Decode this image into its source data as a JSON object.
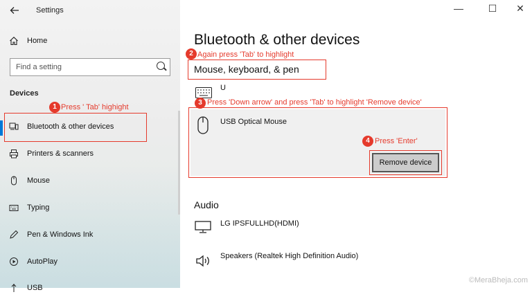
{
  "window": {
    "title": "Settings",
    "controls": {
      "minimize": "—",
      "maximize": "☐",
      "close": "✕"
    }
  },
  "sidebar": {
    "home_label": "Home",
    "search_placeholder": "Find a setting",
    "section_label": "Devices",
    "items": [
      {
        "label": "Bluetooth & other devices",
        "icon": "bluetooth-devices-icon",
        "selected": true
      },
      {
        "label": "Printers & scanners",
        "icon": "printer-icon"
      },
      {
        "label": "Mouse",
        "icon": "mouse-icon"
      },
      {
        "label": "Typing",
        "icon": "keyboard-icon"
      },
      {
        "label": "Pen & Windows Ink",
        "icon": "pen-icon"
      },
      {
        "label": "AutoPlay",
        "icon": "autoplay-icon"
      },
      {
        "label": "USB",
        "icon": "usb-icon"
      }
    ]
  },
  "main": {
    "title": "Bluetooth & other devices",
    "group_heading": "Mouse, keyboard, & pen",
    "devices": [
      {
        "name": "U",
        "icon": "keyboard-icon"
      },
      {
        "name": "USB Optical Mouse",
        "icon": "mouse-icon"
      }
    ],
    "remove_button": "Remove device",
    "audio_heading": "Audio",
    "audio_devices": [
      {
        "name": "LG IPSFULLHD(HDMI)",
        "icon": "monitor-icon"
      },
      {
        "name": "Speakers (Realtek High Definition Audio)",
        "icon": "speaker-icon"
      }
    ]
  },
  "annotations": [
    {
      "number": "1",
      "text": "Press ' Tab' highight"
    },
    {
      "number": "2",
      "text": "Again press 'Tab' to highlight"
    },
    {
      "number": "3",
      "text": "Press 'Down arrow' and press 'Tab' to highlight 'Remove device'"
    },
    {
      "number": "4",
      "text": "Press 'Enter'"
    }
  ],
  "colors": {
    "accent": "#0078d7",
    "annotation": "#e53a2c"
  },
  "watermark": "©MeraBheja.com"
}
